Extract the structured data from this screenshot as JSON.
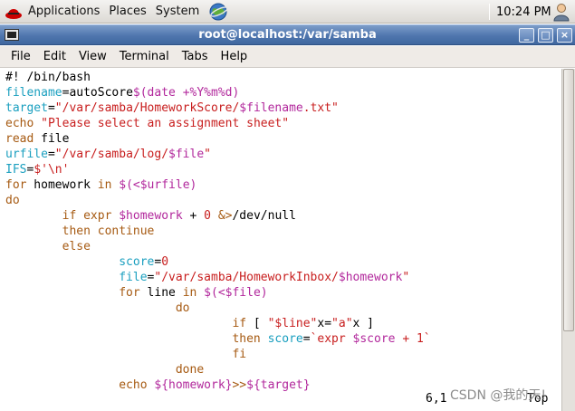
{
  "panel": {
    "applications": "Applications",
    "places": "Places",
    "system": "System",
    "clock": "10:24 PM"
  },
  "window": {
    "title": "root@localhost:/var/samba",
    "minimize": "_",
    "maximize": "□",
    "close": "×"
  },
  "menu": [
    "File",
    "Edit",
    "View",
    "Terminal",
    "Tabs",
    "Help"
  ],
  "code_lines": [
    [
      {
        "t": "#! /bin/bash",
        "c": "black"
      }
    ],
    [
      {
        "t": "filename",
        "c": "cyan"
      },
      {
        "t": "=autoScore",
        "c": "black"
      },
      {
        "t": "$(date +%Y%m%d)",
        "c": "magenta"
      }
    ],
    [
      {
        "t": "target",
        "c": "cyan"
      },
      {
        "t": "=",
        "c": "black"
      },
      {
        "t": "\"/var/samba/HomeworkScore/",
        "c": "red"
      },
      {
        "t": "$filename",
        "c": "magenta"
      },
      {
        "t": ".txt\"",
        "c": "red"
      }
    ],
    [
      {
        "t": "echo ",
        "c": "brown"
      },
      {
        "t": "\"Please select an assignment sheet\"",
        "c": "red"
      }
    ],
    [
      {
        "t": "read",
        "c": "brown"
      },
      {
        "t": " file",
        "c": "black"
      }
    ],
    [
      {
        "t": "urfile",
        "c": "cyan"
      },
      {
        "t": "=",
        "c": "black"
      },
      {
        "t": "\"/var/samba/log/",
        "c": "red"
      },
      {
        "t": "$file",
        "c": "magenta"
      },
      {
        "t": "\"",
        "c": "red"
      }
    ],
    [
      {
        "t": "IFS",
        "c": "cyan"
      },
      {
        "t": "=",
        "c": "black"
      },
      {
        "t": "$'\\n'",
        "c": "red"
      }
    ],
    [
      {
        "t": "for",
        "c": "brown"
      },
      {
        "t": " homework ",
        "c": "black"
      },
      {
        "t": "in",
        "c": "brown"
      },
      {
        "t": " ",
        "c": "black"
      },
      {
        "t": "$(<$urfile)",
        "c": "magenta"
      }
    ],
    [
      {
        "t": "do",
        "c": "brown"
      }
    ],
    [
      {
        "t": "        if expr ",
        "c": "brown"
      },
      {
        "t": "$homework",
        "c": "magenta"
      },
      {
        "t": " + ",
        "c": "black"
      },
      {
        "t": "0",
        "c": "red"
      },
      {
        "t": " ",
        "c": "black"
      },
      {
        "t": "&>",
        "c": "brown"
      },
      {
        "t": "/dev/null",
        "c": "black"
      }
    ],
    [
      {
        "t": "        then continue",
        "c": "brown"
      }
    ],
    [
      {
        "t": "        else",
        "c": "brown"
      }
    ],
    [
      {
        "t": "                ",
        "c": "black"
      },
      {
        "t": "score",
        "c": "cyan"
      },
      {
        "t": "=",
        "c": "black"
      },
      {
        "t": "0",
        "c": "red"
      }
    ],
    [
      {
        "t": "                ",
        "c": "black"
      },
      {
        "t": "file",
        "c": "cyan"
      },
      {
        "t": "=",
        "c": "black"
      },
      {
        "t": "\"/var/samba/HomeworkInbox/",
        "c": "red"
      },
      {
        "t": "$homework",
        "c": "magenta"
      },
      {
        "t": "\"",
        "c": "red"
      }
    ],
    [
      {
        "t": "                for",
        "c": "brown"
      },
      {
        "t": " line ",
        "c": "black"
      },
      {
        "t": "in",
        "c": "brown"
      },
      {
        "t": " ",
        "c": "black"
      },
      {
        "t": "$(<$file)",
        "c": "magenta"
      }
    ],
    [
      {
        "t": "                        do",
        "c": "brown"
      }
    ],
    [
      {
        "t": "                                if",
        "c": "brown"
      },
      {
        "t": " [ ",
        "c": "black"
      },
      {
        "t": "\"$line\"",
        "c": "red"
      },
      {
        "t": "x=",
        "c": "black"
      },
      {
        "t": "\"a\"",
        "c": "red"
      },
      {
        "t": "x ]",
        "c": "black"
      }
    ],
    [
      {
        "t": "                                then ",
        "c": "brown"
      },
      {
        "t": "score",
        "c": "cyan"
      },
      {
        "t": "=",
        "c": "black"
      },
      {
        "t": "`expr ",
        "c": "red"
      },
      {
        "t": "$score",
        "c": "magenta"
      },
      {
        "t": " + 1`",
        "c": "red"
      }
    ],
    [
      {
        "t": "                                fi",
        "c": "brown"
      }
    ],
    [
      {
        "t": "                        done",
        "c": "brown"
      }
    ],
    [
      {
        "t": "                echo ",
        "c": "brown"
      },
      {
        "t": "${homework}",
        "c": "magenta"
      },
      {
        "t": ">>",
        "c": "brown"
      },
      {
        "t": "${target}",
        "c": "magenta"
      }
    ]
  ],
  "status": {
    "position": "6,1",
    "scroll": "Top"
  },
  "watermark": "CSDN @我的天!"
}
